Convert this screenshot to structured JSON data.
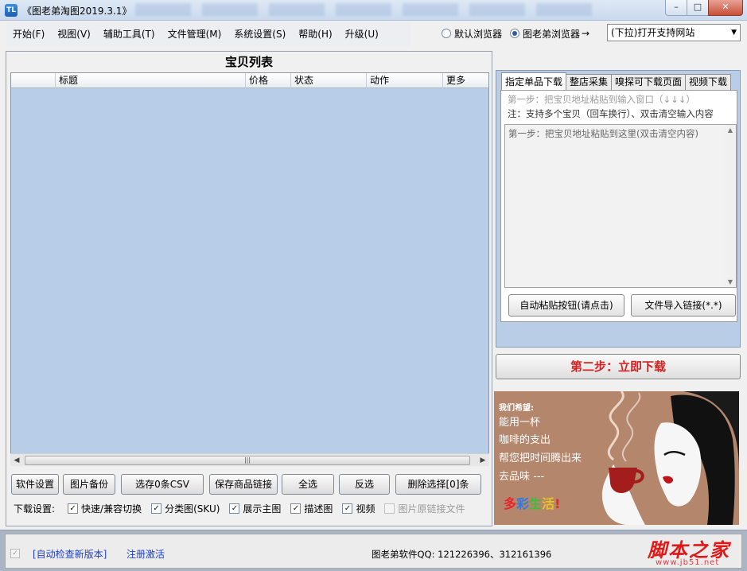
{
  "window": {
    "title": "《图老弟淘图2019.3.1》",
    "app_icon_text": "TL",
    "minimize": "–",
    "maximize": "□",
    "close": "✕"
  },
  "menu": [
    {
      "label": "开始(F)"
    },
    {
      "label": "视图(V)"
    },
    {
      "label": "辅助工具(T)"
    },
    {
      "label": "文件管理(M)"
    },
    {
      "label": "系统设置(S)"
    },
    {
      "label": "帮助(H)"
    },
    {
      "label": "升级(U)"
    }
  ],
  "browser": {
    "default_label": "默认浏览器",
    "tuolaodi_label": "图老弟浏览器",
    "selected": "tuolaodi",
    "arrow": "→",
    "dropdown_value": "(下拉)打开支持网站"
  },
  "list_panel": {
    "title": "宝贝列表",
    "columns": [
      "",
      "标题",
      "价格",
      "状态",
      "动作",
      "更多"
    ]
  },
  "buttons": {
    "settings": "软件设置",
    "image_backup": "图片备份",
    "export_csv": "选存0条CSV",
    "save_links": "保存商品链接",
    "select_all": "全选",
    "invert": "反选",
    "delete": "删除选择[0]条"
  },
  "download_settings": {
    "label": "下载设置:",
    "options": [
      {
        "label": "快速/兼容切换",
        "checked": true,
        "disabled": false
      },
      {
        "label": "分类图(SKU)",
        "checked": true,
        "disabled": false
      },
      {
        "label": "展示主图",
        "checked": true,
        "disabled": false
      },
      {
        "label": "描述图",
        "checked": true,
        "disabled": false
      },
      {
        "label": "视频",
        "checked": true,
        "disabled": false
      },
      {
        "label": "图片原链接文件",
        "checked": false,
        "disabled": true
      }
    ]
  },
  "right_panel": {
    "tabs": [
      "指定单品下载",
      "整店采集",
      "嗅探可下载页面",
      "视频下载"
    ],
    "active_tab": 0,
    "hint1": "第一步：把宝贝地址粘贴到输入窗口（↓↓↓）",
    "hint2": "注：支持多个宝贝（回车换行）、双击清空输入内容",
    "input_placeholder": "第一步：把宝贝地址粘贴到这里(双击清空内容)",
    "paste_button": "自动粘贴按钮(请点击)",
    "import_button": "文件导入链接(*.*)",
    "step2_button": "第二步：立即下载"
  },
  "ad": {
    "head": "我们希望:",
    "lines": [
      "能用一杯",
      "咖啡的支出",
      "帮您把时间腾出来",
      "去品味 ---"
    ],
    "colorful": [
      "多",
      "彩",
      "生",
      "活",
      "!"
    ],
    "colorful_colors": [
      "#e8242a",
      "#2f7ae0",
      "#3bbf3b",
      "#e8c321",
      "#e8242a"
    ]
  },
  "status": {
    "auto_check": "[自动检查新版本]",
    "register": "注册激活",
    "qq": "图老弟软件QQ: 121226396、312161396",
    "watermark_main": "脚本之家",
    "watermark_sub": "www.jb51.net"
  }
}
